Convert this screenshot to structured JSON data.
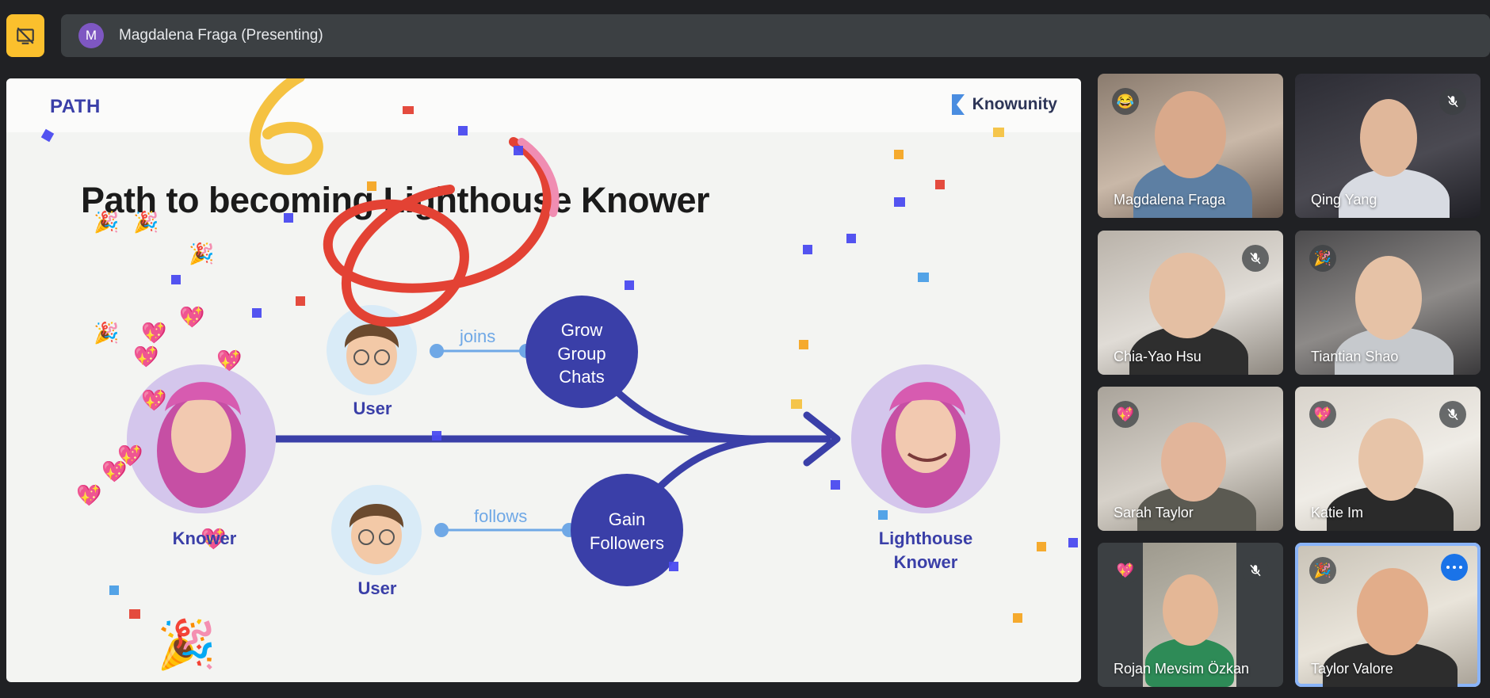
{
  "meeting": {
    "presenter_initial": "M",
    "presenter_label": "Magdalena Fraga (Presenting)",
    "stop_presenting_icon": "present-off-icon"
  },
  "slide": {
    "section": "PATH",
    "brand": "Knowunity",
    "title": "Path to becoming Lighthouse Knower",
    "nodes": {
      "knower": "Knower",
      "user_top": "User",
      "user_bottom": "User",
      "lighthouse_line1": "Lighthouse",
      "lighthouse_line2": "Knower",
      "grow_line1": "Grow",
      "grow_line2": "Group",
      "grow_line3": "Chats",
      "gain_line1": "Gain",
      "gain_line2": "Followers"
    },
    "edges": {
      "joins": "joins",
      "follows": "follows"
    }
  },
  "participants": [
    {
      "name": "Magdalena Fraga",
      "reaction": "😂",
      "muted": false
    },
    {
      "name": "Qing Yang",
      "reaction": "",
      "muted": true
    },
    {
      "name": "Chia-Yao Hsu",
      "reaction": "",
      "muted": true
    },
    {
      "name": "Tiantian Shao",
      "reaction": "🎉",
      "muted": false
    },
    {
      "name": "Sarah Taylor",
      "reaction": "💖",
      "muted": false
    },
    {
      "name": "Katie Im",
      "reaction": "💖",
      "muted": true
    },
    {
      "name": "Rojan Mevsim Özkan",
      "reaction": "💖",
      "muted": true
    },
    {
      "name": "Taylor Valore",
      "reaction": "🎉",
      "muted": false,
      "active": true
    }
  ],
  "colors": {
    "accent_yellow": "#fbc02d",
    "diagram_blue": "#3a3fa8",
    "link_blue": "#6fa8e6",
    "active_outline": "#8ab4f8"
  }
}
